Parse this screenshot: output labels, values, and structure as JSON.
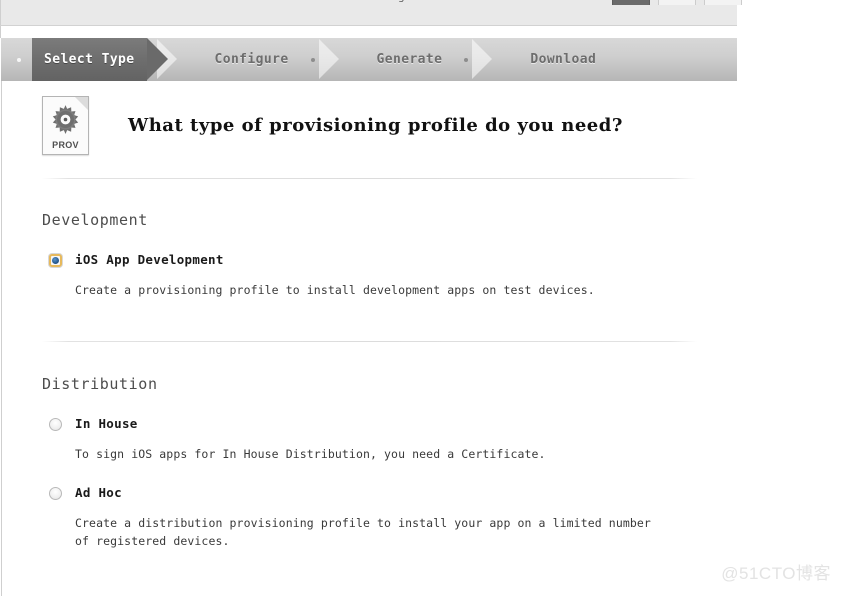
{
  "chrome": {
    "tabs": [
      {
        "name": "tab-1",
        "active": true
      },
      {
        "name": "tab-2",
        "active": false
      },
      {
        "name": "tab-3",
        "active": false
      }
    ],
    "partial_glyph": "g"
  },
  "steps": [
    {
      "label": "Select Type",
      "state": "active"
    },
    {
      "label": "Configure",
      "state": "inactive"
    },
    {
      "label": "Generate",
      "state": "inactive"
    },
    {
      "label": "Download",
      "state": "inactive"
    }
  ],
  "hero": {
    "icon_label": "PROV",
    "icon_name": "provisioning-profile-document-icon",
    "title": "What type of provisioning profile do you need?"
  },
  "sections": [
    {
      "id": "development",
      "title": "Development",
      "options": [
        {
          "id": "ios-app-development",
          "label": "iOS App Development",
          "description": "Create a provisioning profile to install development apps on test devices.",
          "checked": true
        }
      ]
    },
    {
      "id": "distribution",
      "title": "Distribution",
      "options": [
        {
          "id": "in-house",
          "label": "In House",
          "description": "To sign iOS apps for In House Distribution, you need a Certificate.",
          "checked": false
        },
        {
          "id": "ad-hoc",
          "label": "Ad Hoc",
          "description": "Create a distribution provisioning profile to install your app on a limited number of registered devices.",
          "checked": false
        }
      ]
    }
  ],
  "watermark": "@51CTO博客",
  "colors": {
    "step_active_bg": "#6e6e6e",
    "step_bar_bg": "#c6c6c6",
    "radio_checked_border": "#e7b95b",
    "radio_checked_dot": "#2a5f96",
    "divider": "#dcdcdc",
    "watermark": "#e3e3e3"
  }
}
